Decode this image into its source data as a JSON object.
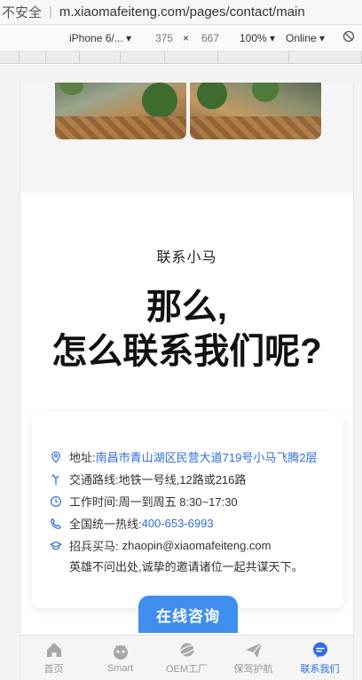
{
  "browser": {
    "security": "不安全",
    "url": "m.xiaomafeiteng.com/pages/contact/main"
  },
  "devtools": {
    "device": "iPhone 6/...",
    "width": "375",
    "times": "×",
    "height": "667",
    "zoom": "100%",
    "network": "Online"
  },
  "page": {
    "subtitle": "联系小马",
    "headline_line1": "那么,",
    "headline_line2": "怎么联系我们呢?"
  },
  "contact": {
    "address_label": "地址:",
    "address_value": "南昌市青山湖区民营大道719号小马飞腾2层",
    "route_label": "交通路线:",
    "route_value": "地铁一号线,12路或216路",
    "hours_label": "工作时间:",
    "hours_value": "周一到周五 8:30~17:30",
    "hotline_label": "全国统一热线:",
    "hotline_value": "400-653-6993",
    "recruit_label": "招兵买马:",
    "recruit_value": "zhaopin@xiaomafeiteng.com",
    "motto": "英雄不问出处,诚挚的邀请诸位一起共谋天下。"
  },
  "consult_button": "在线咨询",
  "tabs": [
    {
      "label": "首页",
      "icon": "home-icon"
    },
    {
      "label": "Smart",
      "icon": "robot-icon"
    },
    {
      "label": "OEM工厂",
      "icon": "planet-icon"
    },
    {
      "label": "保驾护航",
      "icon": "paper-plane-icon"
    },
    {
      "label": "联系我们",
      "icon": "message-icon"
    }
  ],
  "colors": {
    "accent": "#2f6ce5",
    "button": "#3f8ef0",
    "tab_inactive": "#999999"
  }
}
